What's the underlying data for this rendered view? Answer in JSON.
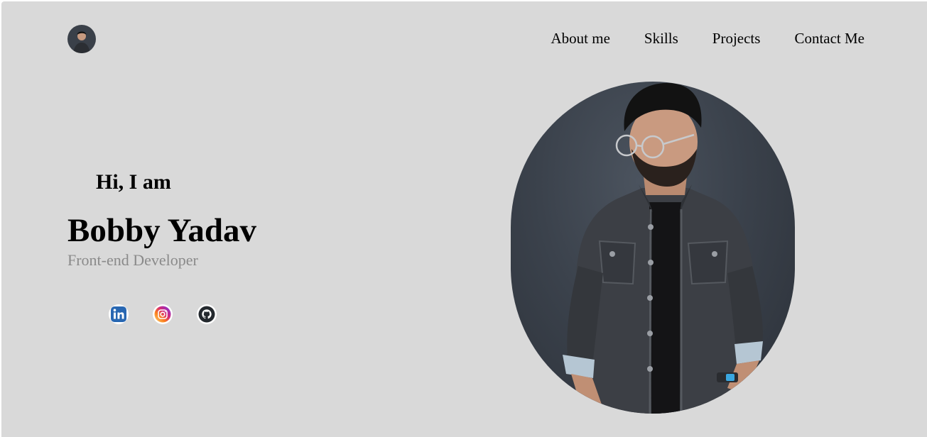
{
  "nav": {
    "items": [
      {
        "label": "About me"
      },
      {
        "label": "Skills"
      },
      {
        "label": "Projects"
      },
      {
        "label": "Contact Me"
      }
    ]
  },
  "hero": {
    "greeting": "Hi, I am",
    "name": "Bobby Yadav",
    "role": "Front-end Developer"
  },
  "socials": [
    {
      "icon": "linkedin-icon",
      "color": "#2867b2"
    },
    {
      "icon": "instagram-icon",
      "color": "#dd2a7b"
    },
    {
      "icon": "github-icon",
      "color": "#24292e"
    }
  ],
  "colors": {
    "background": "#d9d9d9",
    "role_text": "#8a8a8a",
    "text": "#000000"
  }
}
